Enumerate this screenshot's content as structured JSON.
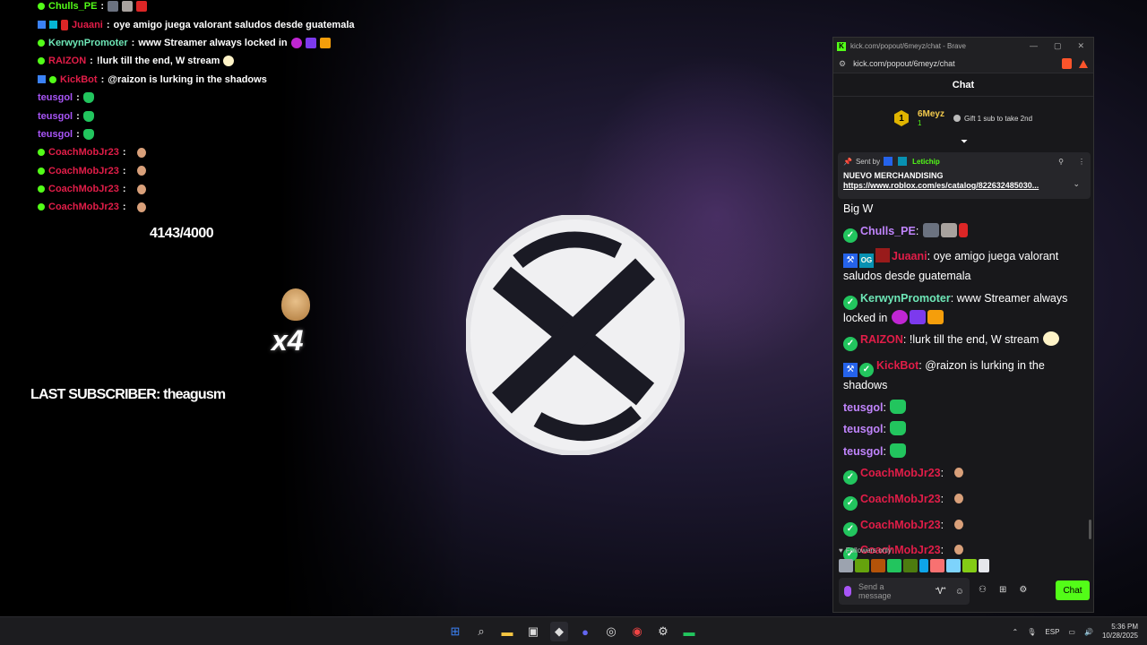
{
  "overlay": {
    "chat": [
      {
        "user": "Chulls_PE",
        "color": "#53fc18",
        "msg": ""
      },
      {
        "user": "Juaani",
        "color": "#e11d48",
        "msg": "oye amigo juega valorant saludos desde guatemala"
      },
      {
        "user": "KerwynPromoter",
        "color": "#6ee7b7",
        "msg": "www Streamer always locked in"
      },
      {
        "user": "RAIZON",
        "color": "#e11d48",
        "msg": "!lurk till the end,  W  stream"
      },
      {
        "user": "KickBot",
        "color": "#e11d48",
        "msg": "@raizon is lurking in the shadows"
      },
      {
        "user": "teusgol",
        "color": "#a855f7",
        "msg": ""
      },
      {
        "user": "teusgol",
        "color": "#a855f7",
        "msg": ""
      },
      {
        "user": "teusgol",
        "color": "#a855f7",
        "msg": ""
      },
      {
        "user": "CoachMobJr23",
        "color": "#e11d48",
        "msg": ""
      },
      {
        "user": "CoachMobJr23",
        "color": "#e11d48",
        "msg": ""
      },
      {
        "user": "CoachMobJr23",
        "color": "#e11d48",
        "msg": ""
      },
      {
        "user": "CoachMobJr23",
        "color": "#e11d48",
        "msg": ""
      }
    ],
    "goal_counter": "4143/4000",
    "multiplier": "x4",
    "last_subscriber": "LAST SUBSCRIBER: theagusm"
  },
  "browser": {
    "tab_title": "kick.com/popout/6meyz/chat - Brave",
    "url": "kick.com/popout/6meyz/chat",
    "chat_title": "Chat",
    "top_gifter": {
      "rank": "1",
      "name": "6Meyz",
      "count": "1",
      "gift_text": "Gift 1 sub to take 2nd"
    },
    "pinned": {
      "sent_by": "Sent by",
      "user": "Letichip",
      "title": "NUEVO MERCHANDISING",
      "link": "https://www.roblox.com/es/catalog/822632485030..."
    },
    "messages": [
      {
        "user": "",
        "text": "Big W"
      },
      {
        "user": "Chulls_PE",
        "color": "#c084fc",
        "text": ""
      },
      {
        "user": "Juaani",
        "color": "#e11d48",
        "text": "oye amigo juega valorant saludos desde guatemala"
      },
      {
        "user": "KerwynPromoter",
        "color": "#6ee7b7",
        "text": "www Streamer always locked in"
      },
      {
        "user": "RAIZON",
        "color": "#e11d48",
        "text": "!lurk till the end,  W stream"
      },
      {
        "user": "KickBot",
        "color": "#e11d48",
        "text": "@raizon is lurking in the shadows"
      },
      {
        "user": "teusgol",
        "color": "#c084fc",
        "text": ""
      },
      {
        "user": "teusgol",
        "color": "#c084fc",
        "text": ""
      },
      {
        "user": "teusgol",
        "color": "#c084fc",
        "text": ""
      },
      {
        "user": "CoachMobJr23",
        "color": "#e11d48",
        "text": ""
      },
      {
        "user": "CoachMobJr23",
        "color": "#e11d48",
        "text": ""
      },
      {
        "user": "CoachMobJr23",
        "color": "#e11d48",
        "text": ""
      },
      {
        "user": "CoachMobJr23",
        "color": "#e11d48",
        "text": ""
      }
    ],
    "followers_only": "Followers only",
    "input_placeholder": "Send a message",
    "chat_button": "Chat"
  },
  "taskbar": {
    "lang": "ESP",
    "time": "5:36 PM",
    "date": "10/28/2025"
  },
  "colors": {
    "kick_green": "#53fc18"
  }
}
